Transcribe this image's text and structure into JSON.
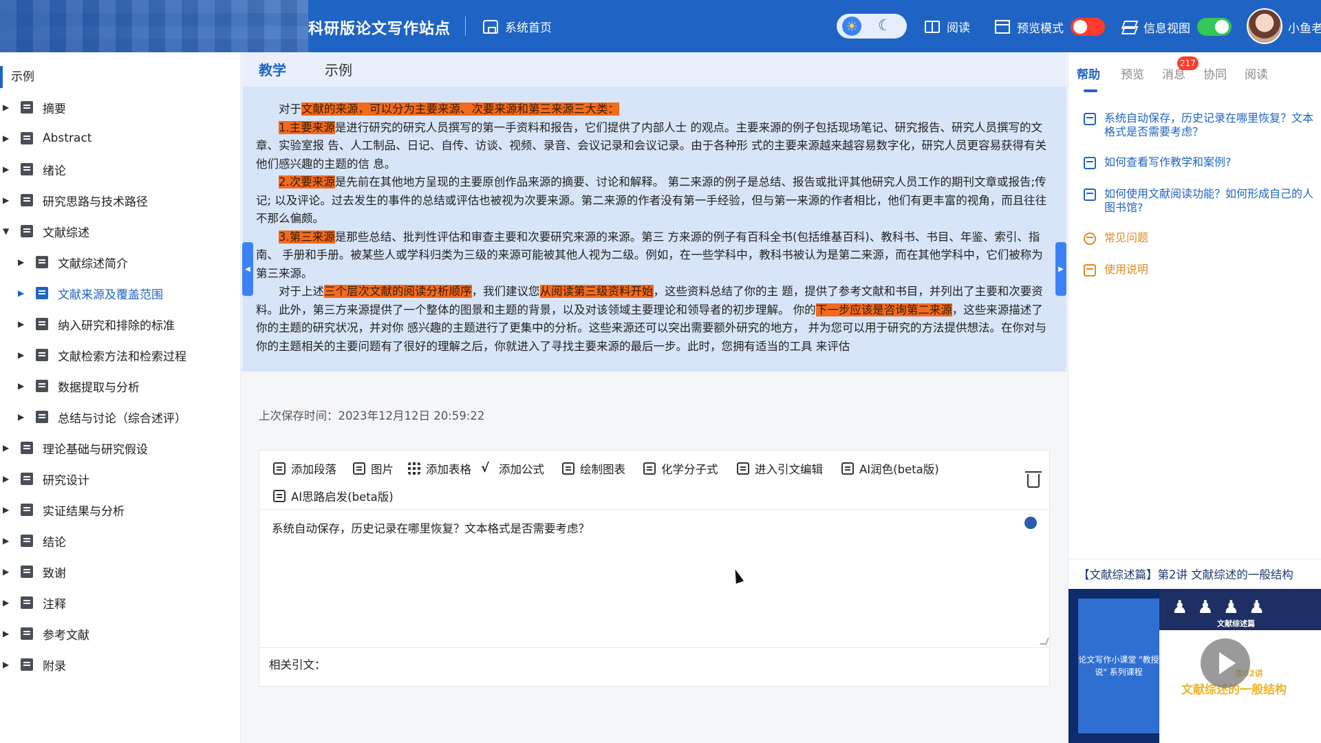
{
  "header": {
    "site_title": "科研版论文写作站点",
    "home": "系统首页",
    "read": "阅读",
    "preview_mode": "预览模式",
    "info_view": "信息视图",
    "user_name": "小鱼老",
    "preview_switch_on": false,
    "info_switch_on": true
  },
  "sidebar": {
    "root": "示例",
    "items": [
      {
        "label": "摘要",
        "level": 0,
        "expanded": false
      },
      {
        "label": "Abstract",
        "level": 0,
        "expanded": false
      },
      {
        "label": "绪论",
        "level": 0,
        "expanded": false
      },
      {
        "label": "研究思路与技术路径",
        "level": 0,
        "expanded": false
      },
      {
        "label": "文献综述",
        "level": 0,
        "expanded": true
      },
      {
        "label": "文献综述简介",
        "level": 1,
        "expanded": false
      },
      {
        "label": "文献来源及覆盖范围",
        "level": 1,
        "expanded": false,
        "active": true
      },
      {
        "label": "纳入研究和排除的标准",
        "level": 1,
        "expanded": false
      },
      {
        "label": "文献检索方法和检索过程",
        "level": 1,
        "expanded": false
      },
      {
        "label": "数据提取与分析",
        "level": 1,
        "expanded": false
      },
      {
        "label": "总结与讨论（综合述评）",
        "level": 1,
        "expanded": false
      },
      {
        "label": "理论基础与研究假设",
        "level": 0,
        "expanded": false
      },
      {
        "label": "研究设计",
        "level": 0,
        "expanded": false
      },
      {
        "label": "实证结果与分析",
        "level": 0,
        "expanded": false
      },
      {
        "label": "结论",
        "level": 0,
        "expanded": false
      },
      {
        "label": "致谢",
        "level": 0,
        "expanded": false
      },
      {
        "label": "注释",
        "level": 0,
        "expanded": false
      },
      {
        "label": "参考文献",
        "level": 0,
        "expanded": false
      },
      {
        "label": "附录",
        "level": 0,
        "expanded": false
      }
    ]
  },
  "center_tabs": [
    "教学",
    "示例"
  ],
  "reading": {
    "p1": {
      "t1": "对于",
      "h1": "文献的来源，可以分为主要来源、次要来源和第三来源三大类："
    },
    "p2": {
      "h1": "1.主要来源",
      "t1": "是进行研究的研究人员撰写的第一手资料和报告，它们提供了内部人士 的观点。主要来源的例子包括现场笔记、研究报告、研究人员撰写的文章、实验室报 告、人工制品、日记、自传、访谈、视频、录音、会议记录和会议记录。由于各种形 式的主要来源越来越容易数字化，研究人员更容易获得有关他们感兴趣的主题的信 息。"
    },
    "p3": {
      "h1": "2.次要来源",
      "t1": "是先前在其他地方呈现的主要原创作品来源的摘要、讨论和解释。 第二来源的例子是总结、报告或批评其他研究人员工作的期刊文章或报告;传记; 以及评论。过去发生的事件的总结或评估也被视为次要来源。第二来源的作者没有第一手经验，但与第一来源的作者相比，他们有更丰富的视角，而且往往不那么偏颇。"
    },
    "p4": {
      "h1": "3.第三来源",
      "t1": "是那些总结、批判性评估和审查主要和次要研究来源的来源。第三 方来源的例子有百科全书(包括维基百科)、教科书、书目、年鉴、索引、指南、 手册和手册。被某些人或学科归类为三级的来源可能被其他人视为二级。例如，在一些学科中，教科书被认为是第二来源，而在其他学科中，它们被称为第三来源。"
    },
    "p5": {
      "t1": "对于上述",
      "h1": "三个层次文献的阅读分析顺序",
      "t2": "，我们建议您",
      "h2": "从阅读第三级资料开始",
      "t3": "，这些资料总结了你的主 题，提供了参考文献和书目，并列出了主要和次要资料。此外，第三方来源提供了一个整体的图景和主题的背景，以及对该领域主要理论和领导者的初步理解。 你的",
      "h3": "下一步应该是咨询第二来源",
      "t4": "，这些来源描述了你的主题的研究状况，并对你 感兴趣的主题进行了更集中的分析。这些来源还可以突出需要额外研究的地方， 并为您可以用于研究的方法提供想法。在你对与你的主题相关的主要问题有了很好的理解之后，你就进入了寻找主要来源的最后一步。此时，您拥有适当的工具 来评估"
    }
  },
  "save_time": "上次保存时间：2023年12月12日 20:59:22",
  "toolbar": [
    "添加段落",
    "图片",
    "添加表格",
    "添加公式",
    "绘制图表",
    "化学分子式",
    "进入引文编辑",
    "AI润色(beta版)",
    "AI思路启发(beta版)"
  ],
  "editor": {
    "content": "系统自动保存，历史记录在哪里恢复？文本格式是否需要考虑？",
    "related_label": "相关引文："
  },
  "right_panel": {
    "tabs": [
      "帮助",
      "预览",
      "消息",
      "协同",
      "阅读"
    ],
    "badge": "217",
    "help_links": [
      "系统自动保存，历史记录在哪里恢复？文本格式是否需要考虑？",
      "如何查看写作教学和案例?",
      "如何使用文献阅读功能？如何形成自己的人图书馆?",
      "常见问题",
      "使用说明"
    ],
    "video_title": "【文献综述篇】第2讲 文献综述的一般结构",
    "video": {
      "left_text": "论文写作小课堂 \"教授说\" 系列课程",
      "tag": "文献综述篇",
      "lecture": "第02讲",
      "subtitle": "文献综述的一般结构"
    }
  },
  "colors": {
    "brand": "#1f64c4",
    "highlight": "#f26b1d",
    "reading_bg": "#d8e5f8"
  }
}
